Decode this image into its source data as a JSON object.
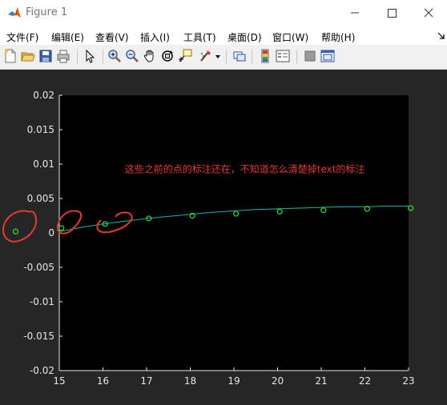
{
  "window": {
    "title": "Figure 1"
  },
  "menu": [
    {
      "label": "文件(F)"
    },
    {
      "label": "编辑(E)"
    },
    {
      "label": "查看(V)"
    },
    {
      "label": "插入(I)"
    },
    {
      "label": "工具(T)"
    },
    {
      "label": "桌面(D)"
    },
    {
      "label": "窗口(W)"
    },
    {
      "label": "帮助(H)"
    }
  ],
  "toolbar": {
    "buttons": [
      {
        "icon": "new-figure-icon"
      },
      {
        "icon": "open-file-icon"
      },
      {
        "icon": "save-icon"
      },
      {
        "icon": "print-icon"
      },
      {
        "icon": "edit-plot-arrow-icon"
      },
      {
        "icon": "zoom-in-icon"
      },
      {
        "icon": "zoom-out-icon"
      },
      {
        "icon": "pan-hand-icon"
      },
      {
        "icon": "rotate-3d-icon"
      },
      {
        "icon": "data-cursor-icon"
      },
      {
        "icon": "brush-icon"
      },
      {
        "icon": "link-plot-icon"
      },
      {
        "icon": "colorbar-icon"
      },
      {
        "icon": "legend-icon"
      },
      {
        "icon": "hide-plot-tools-icon"
      },
      {
        "icon": "show-plot-tools-icon"
      }
    ]
  },
  "colors": {
    "figure_bg": "#262626",
    "axes_bg": "#000000",
    "axis_text": "#e6e6e6",
    "line": "#20b2aa",
    "markers": "#33dd33",
    "annotation": "#e53935"
  },
  "chart_data": {
    "type": "line",
    "xlim": [
      15,
      23
    ],
    "ylim": [
      -0.02,
      0.02
    ],
    "x_ticks": [
      "15",
      "16",
      "17",
      "18",
      "19",
      "20",
      "21",
      "22",
      "23"
    ],
    "y_ticks": [
      "0.02",
      "0.015",
      "0.01",
      "0.005",
      "0",
      "-0.005",
      "-0.01",
      "-0.015",
      "-0.02"
    ],
    "grid": false,
    "series": [
      {
        "style": "line",
        "x": [
          15,
          15.5,
          16,
          16.5,
          17,
          17.5,
          18,
          18.5,
          19,
          19.5,
          20,
          20.5,
          21,
          21.5,
          22,
          22.5,
          23
        ],
        "y": [
          0.0002,
          0.0008,
          0.0013,
          0.0017,
          0.0021,
          0.0024,
          0.0027,
          0.003,
          0.0032,
          0.0034,
          0.0035,
          0.0036,
          0.0037,
          0.0038,
          0.0038,
          0.0039,
          0.0039
        ]
      },
      {
        "style": "markers",
        "x": [
          15.05,
          16.05,
          17.05,
          18.05,
          19.05,
          20.05,
          21.05,
          22.05,
          23.05
        ],
        "y": [
          0.0007,
          0.0013,
          0.0021,
          0.0025,
          0.0028,
          0.0031,
          0.0033,
          0.0035,
          0.0036
        ]
      },
      {
        "style": "markers",
        "x": [
          14.0
        ],
        "y": [
          0.0002
        ]
      }
    ],
    "annotation": {
      "text": "这些之前的点的标注还在，不知道怎么清楚掉text的标注",
      "x": 16.5,
      "y": 0.0088
    }
  }
}
